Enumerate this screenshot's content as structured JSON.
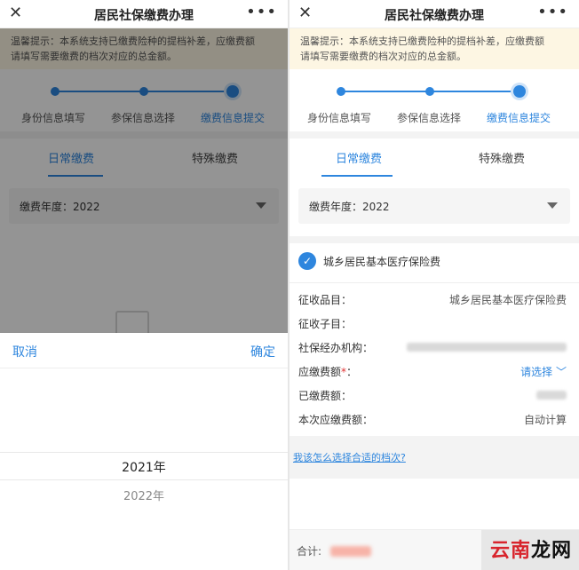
{
  "header": {
    "close_glyph": "✕",
    "title": "居民社保缴费办理",
    "more_glyph": "•••"
  },
  "notice": {
    "line1": "温馨提示：本系统支持已缴费险种的提档补差，应缴费额",
    "line2": "请填写需要缴费的档次对应的总金额。"
  },
  "steps": [
    "身份信息填写",
    "参保信息选择",
    "缴费信息提交"
  ],
  "tabs": [
    "日常缴费",
    "特殊缴费"
  ],
  "year": {
    "label": "缴费年度：2022"
  },
  "picker": {
    "cancel": "取消",
    "confirm": "确定",
    "options": [
      "2021年",
      "2022年"
    ]
  },
  "insurance": {
    "name": "城乡居民基本医疗保险费"
  },
  "fields": {
    "collect_item_label": "征收品目：",
    "collect_item_value": "城乡居民基本医疗保险费",
    "collect_sub_label": "征收子目：",
    "agency_label": "社保经办机构：",
    "due_label": "应缴费额",
    "due_required": "*",
    "due_colon": "：",
    "due_value": "请选择 ﹀",
    "paid_label": "已缴费额：",
    "current_label": "本次应缴费额：",
    "current_value": "自动计算"
  },
  "help": {
    "link": "我该怎么选择合适的档次?"
  },
  "footer": {
    "total_label": "合计:"
  },
  "watermark": {
    "part1": "云南",
    "part2": "龙网"
  }
}
